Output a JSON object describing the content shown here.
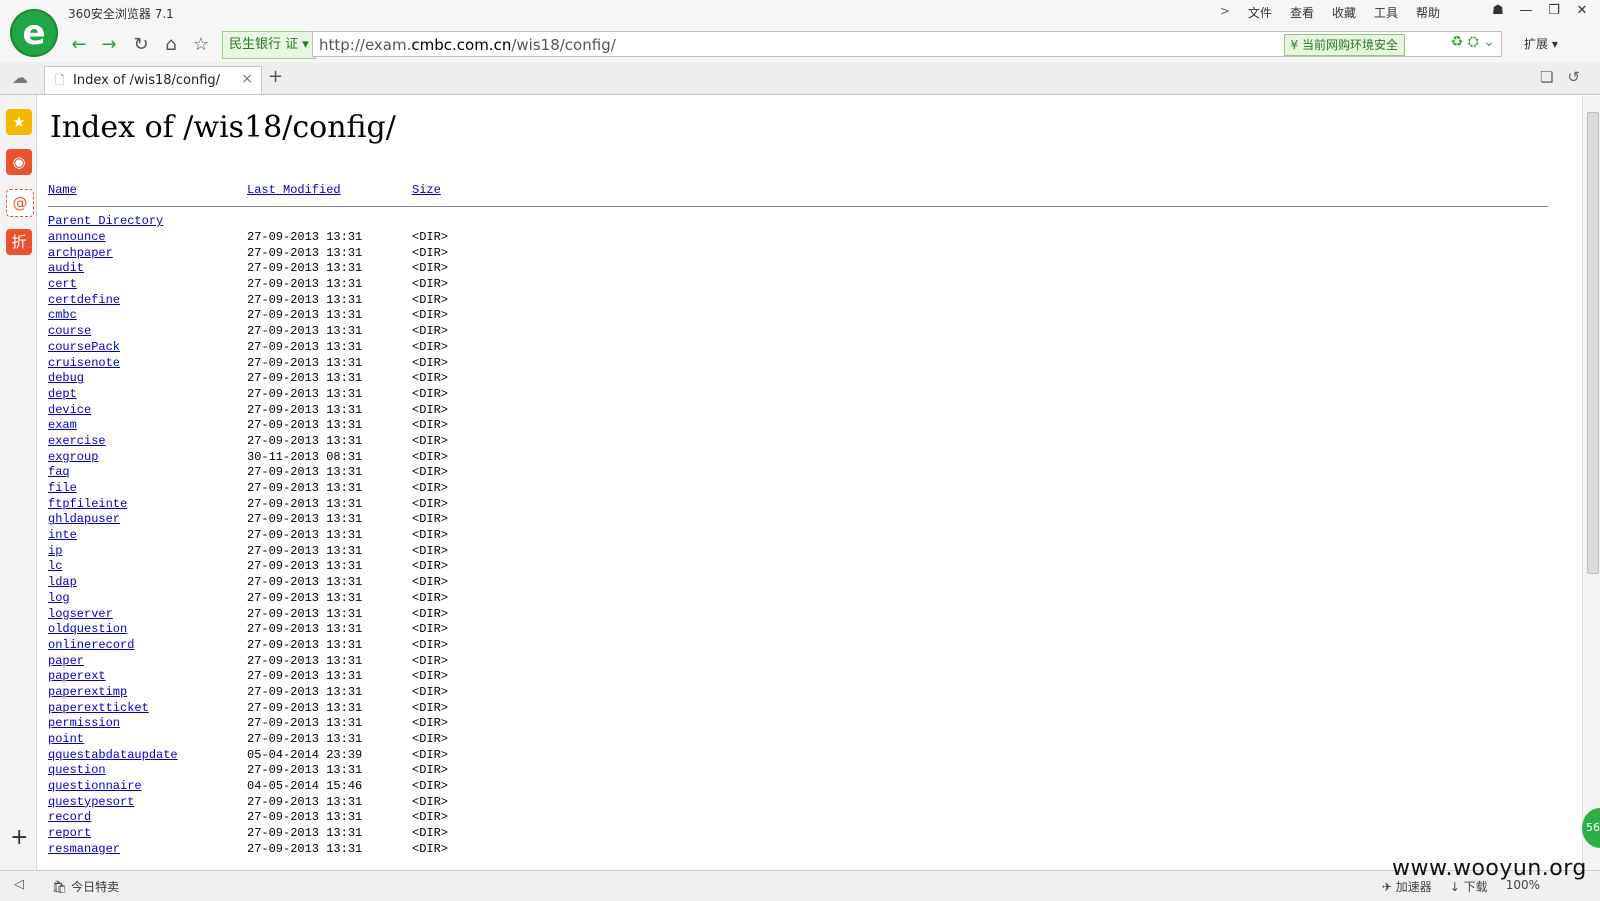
{
  "app": {
    "title": "360安全浏览器 7.1",
    "logo_letter": "e"
  },
  "menu": {
    "chevron": ">",
    "items": [
      "文件",
      "查看",
      "收藏",
      "工具",
      "帮助"
    ]
  },
  "window": {
    "skin": "☗",
    "minimize": "—",
    "maximize": "❐",
    "close": "✕"
  },
  "nav": {
    "back": "←",
    "forward": "→",
    "refresh": "↻",
    "home": "⌂",
    "favorite": "☆",
    "bank_badge": "民生银行 证 ▾",
    "url_prefix": "http://exam.",
    "url_domain": "cmbc.com.cn",
    "url_path": "/wis18/config/",
    "safe_badge": "¥ 当前网购环境安全",
    "addr_icons": "♻ ⛭  ⌄",
    "extensions": "扩展 ▾"
  },
  "tabs": {
    "active_title": "Index of /wis18/config/",
    "close": "×",
    "new": "+"
  },
  "sidebar": {
    "favorites": "★",
    "weibo": "◉",
    "mail": "@",
    "discount": "折",
    "add": "+"
  },
  "page": {
    "heading": "Index of /wis18/config/",
    "col_name": "Name",
    "col_modified": "Last Modified",
    "col_size": "Size",
    "parent": "Parent Directory",
    "rows": [
      {
        "name": "announce",
        "date": "27-09-2013 13:31",
        "size": "<DIR>"
      },
      {
        "name": "archpaper",
        "date": "27-09-2013 13:31",
        "size": "<DIR>"
      },
      {
        "name": "audit",
        "date": "27-09-2013 13:31",
        "size": "<DIR>"
      },
      {
        "name": "cert",
        "date": "27-09-2013 13:31",
        "size": "<DIR>"
      },
      {
        "name": "certdefine",
        "date": "27-09-2013 13:31",
        "size": "<DIR>"
      },
      {
        "name": "cmbc",
        "date": "27-09-2013 13:31",
        "size": "<DIR>"
      },
      {
        "name": "course",
        "date": "27-09-2013 13:31",
        "size": "<DIR>"
      },
      {
        "name": "coursePack",
        "date": "27-09-2013 13:31",
        "size": "<DIR>"
      },
      {
        "name": "cruisenote",
        "date": "27-09-2013 13:31",
        "size": "<DIR>"
      },
      {
        "name": "debug",
        "date": "27-09-2013 13:31",
        "size": "<DIR>"
      },
      {
        "name": "dept",
        "date": "27-09-2013 13:31",
        "size": "<DIR>"
      },
      {
        "name": "device",
        "date": "27-09-2013 13:31",
        "size": "<DIR>"
      },
      {
        "name": "exam",
        "date": "27-09-2013 13:31",
        "size": "<DIR>"
      },
      {
        "name": "exercise",
        "date": "27-09-2013 13:31",
        "size": "<DIR>"
      },
      {
        "name": "exgroup",
        "date": "30-11-2013 08:31",
        "size": "<DIR>"
      },
      {
        "name": "faq",
        "date": "27-09-2013 13:31",
        "size": "<DIR>"
      },
      {
        "name": "file",
        "date": "27-09-2013 13:31",
        "size": "<DIR>"
      },
      {
        "name": "ftpfileinte",
        "date": "27-09-2013 13:31",
        "size": "<DIR>"
      },
      {
        "name": "ghldapuser",
        "date": "27-09-2013 13:31",
        "size": "<DIR>"
      },
      {
        "name": "inte",
        "date": "27-09-2013 13:31",
        "size": "<DIR>"
      },
      {
        "name": "ip",
        "date": "27-09-2013 13:31",
        "size": "<DIR>"
      },
      {
        "name": "lc",
        "date": "27-09-2013 13:31",
        "size": "<DIR>"
      },
      {
        "name": "ldap",
        "date": "27-09-2013 13:31",
        "size": "<DIR>"
      },
      {
        "name": "log",
        "date": "27-09-2013 13:31",
        "size": "<DIR>"
      },
      {
        "name": "logserver",
        "date": "27-09-2013 13:31",
        "size": "<DIR>"
      },
      {
        "name": "oldquestion",
        "date": "27-09-2013 13:31",
        "size": "<DIR>"
      },
      {
        "name": "onlinerecord",
        "date": "27-09-2013 13:31",
        "size": "<DIR>"
      },
      {
        "name": "paper",
        "date": "27-09-2013 13:31",
        "size": "<DIR>"
      },
      {
        "name": "paperext",
        "date": "27-09-2013 13:31",
        "size": "<DIR>"
      },
      {
        "name": "paperextimp",
        "date": "27-09-2013 13:31",
        "size": "<DIR>"
      },
      {
        "name": "paperextticket",
        "date": "27-09-2013 13:31",
        "size": "<DIR>"
      },
      {
        "name": "permission",
        "date": "27-09-2013 13:31",
        "size": "<DIR>"
      },
      {
        "name": "point",
        "date": "27-09-2013 13:31",
        "size": "<DIR>"
      },
      {
        "name": "qquestabdataupdate",
        "date": "05-04-2014 23:39",
        "size": "<DIR>"
      },
      {
        "name": "question",
        "date": "27-09-2013 13:31",
        "size": "<DIR>"
      },
      {
        "name": "questionnaire",
        "date": "04-05-2014 15:46",
        "size": "<DIR>"
      },
      {
        "name": "questypesort",
        "date": "27-09-2013 13:31",
        "size": "<DIR>"
      },
      {
        "name": "record",
        "date": "27-09-2013 13:31",
        "size": "<DIR>"
      },
      {
        "name": "report",
        "date": "27-09-2013 13:31",
        "size": "<DIR>"
      },
      {
        "name": "resmanager",
        "date": "27-09-2013 13:31",
        "size": "<DIR>"
      }
    ]
  },
  "floating_badge": "56",
  "statusbar": {
    "back": "◁",
    "today_deals": "今日特卖",
    "accelerator": "加速器",
    "download": "下载",
    "zoom": "100%"
  },
  "watermark": "www.wooyun.org",
  "colors": {
    "brand_green": "#22a544",
    "link": "#0000cc"
  }
}
